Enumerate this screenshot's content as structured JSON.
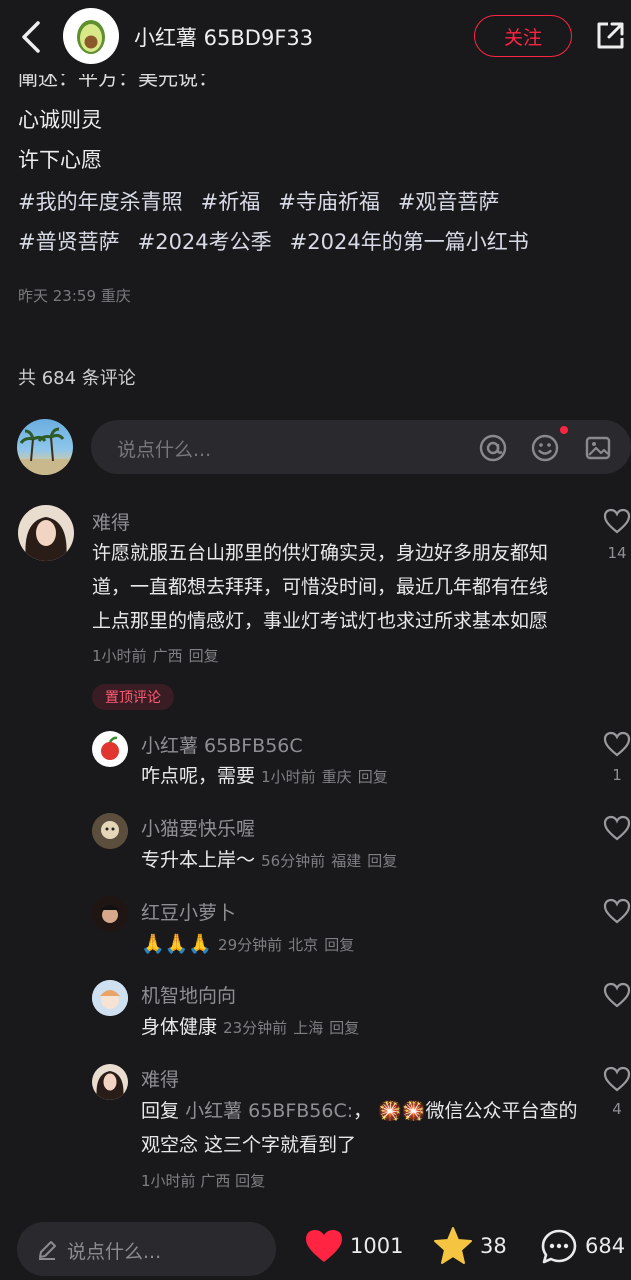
{
  "header": {
    "author": "小红薯 65BD9F33",
    "follow_label": "关注"
  },
  "post": {
    "cut_line": "阐述：平方：美元说：",
    "lines": [
      "心诚则灵",
      "许下心愿"
    ],
    "hashtags": [
      "#我的年度杀青照",
      "#祈福",
      "#寺庙祈福",
      "#观音菩萨",
      "#普贤菩萨",
      "#2024考公季",
      "#2024年的第一篇小红书"
    ],
    "meta": "昨天 23:59 重庆"
  },
  "comments_header": "共 684 条评论",
  "comment_input": {
    "placeholder": "说点什么..."
  },
  "comments": [
    {
      "name": "难得",
      "text": "许愿就服五台山那里的供灯确实灵，身边好多朋友都知道，一直都想去拜拜，可惜没时间，最近几年都有在线上点那里的情感灯，事业灯考试灯也求过所求基本如愿",
      "time": "1小时前",
      "location": "广西",
      "reply": "回复",
      "likes": "14",
      "badge": "置顶评论"
    },
    {
      "name": "小红薯 65BFB56C",
      "text": "咋点呢，需要",
      "time": "1小时前",
      "location": "重庆",
      "reply": "回复",
      "likes": "1"
    },
    {
      "name": "小猫要快乐喔",
      "text": "专升本上岸～",
      "time": "56分钟前",
      "location": "福建",
      "reply": "回复",
      "likes": ""
    },
    {
      "name": "红豆小萝卜",
      "text": "🙏🙏🙏",
      "time": "29分钟前",
      "location": "北京",
      "reply": "回复",
      "likes": ""
    },
    {
      "name": "机智地向向",
      "text": "身体健康",
      "time": "23分钟前",
      "location": "上海",
      "reply": "回复",
      "likes": ""
    },
    {
      "name": "难得",
      "reply_prefix": "回复",
      "reply_to": "小红薯 65BFB56C:",
      "text_a": "，",
      "emoji": "🎇🎇",
      "text_b": "微信公众平台查的 观空念 这三个字就看到了",
      "time": "1小时前",
      "location": "广西",
      "reply": "回复",
      "likes": "4"
    }
  ],
  "bottom": {
    "placeholder": "说点什么...",
    "likes": "1001",
    "stars": "38",
    "comments": "684"
  },
  "colors": {
    "accent": "#ff2442",
    "background": "#19191c",
    "star": "#f5c542"
  }
}
